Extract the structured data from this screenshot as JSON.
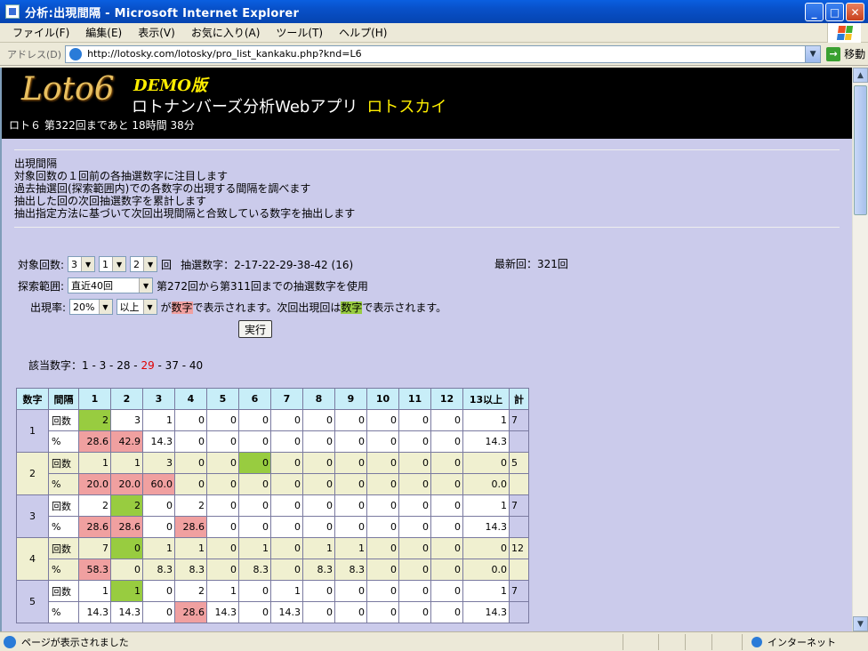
{
  "window": {
    "title": "分析:出現間隔 - Microsoft Internet Explorer"
  },
  "menu": [
    "ファイル(F)",
    "編集(E)",
    "表示(V)",
    "お気に入り(A)",
    "ツール(T)",
    "ヘルプ(H)"
  ],
  "address": {
    "label": "アドレス(D)",
    "url": "http://lotosky.com/lotosky/pro_list_kankaku.php?knd=L6",
    "go_label": "移動"
  },
  "header": {
    "logo": "Loto6",
    "demo": "DEMO版",
    "app_name": "ロトナンバーズ分析Webアプリ",
    "brand": "ロトスカイ",
    "countdown": "ロト６ 第322回まであと 18時間 38分"
  },
  "description": [
    "出現間隔",
    "対象回数の１回前の各抽選数字に注目します",
    "過去抽選回(探索範囲内)での各数字の出現する間隔を調べます",
    "抽出した回の次回抽選数字を累計します",
    "抽出指定方法に基づいて次回出現間隔と合致している数字を抽出します"
  ],
  "form": {
    "target_label": "対象回数:",
    "target_digits": [
      "3",
      "1",
      "2"
    ],
    "target_suffix": "回",
    "drawn_numbers": "抽選数字：2-17-22-29-38-42 (16)",
    "latest": "最新回：321回",
    "range_label": "探索範囲:",
    "range_value": "直近40回",
    "range_note": "第272回から第311回までの抽選数字を使用",
    "rate_label": "出現率:",
    "rate_value": "20%",
    "rate_cmp": "以上",
    "rate_note_1": "が",
    "rate_word_red": "数字",
    "rate_note_2": "で表示されます。次回出現回は",
    "rate_word_green": "数字",
    "rate_note_3": "で表示されます。",
    "submit": "実行"
  },
  "matched": {
    "label": "該当数字：",
    "pre": "1 - 3 - 28 - ",
    "red": "29",
    "post": " - 37 - 40"
  },
  "table": {
    "headers": [
      "数字",
      "間隔",
      "1",
      "2",
      "3",
      "4",
      "5",
      "6",
      "7",
      "8",
      "9",
      "10",
      "11",
      "12",
      "13以上",
      "計"
    ],
    "count_label": "回数",
    "pct_label": "%",
    "rows": [
      {
        "digit": "1",
        "counts": [
          "2",
          "3",
          "1",
          "0",
          "0",
          "0",
          "0",
          "0",
          "0",
          "0",
          "0",
          "0",
          "1"
        ],
        "total": "7",
        "pcts": [
          "28.6",
          "42.9",
          "14.3",
          "0",
          "0",
          "0",
          "0",
          "0",
          "0",
          "0",
          "0",
          "0",
          "14.3"
        ],
        "green": [
          0
        ],
        "red": [
          0,
          1
        ]
      },
      {
        "digit": "2",
        "counts": [
          "1",
          "1",
          "3",
          "0",
          "0",
          "0",
          "0",
          "0",
          "0",
          "0",
          "0",
          "0",
          "0"
        ],
        "total": "5",
        "pcts": [
          "20.0",
          "20.0",
          "60.0",
          "0",
          "0",
          "0",
          "0",
          "0",
          "0",
          "0",
          "0",
          "0",
          "0.0"
        ],
        "green": [
          5
        ],
        "red": [
          0,
          1,
          2
        ]
      },
      {
        "digit": "3",
        "counts": [
          "2",
          "2",
          "0",
          "2",
          "0",
          "0",
          "0",
          "0",
          "0",
          "0",
          "0",
          "0",
          "1"
        ],
        "total": "7",
        "pcts": [
          "28.6",
          "28.6",
          "0",
          "28.6",
          "0",
          "0",
          "0",
          "0",
          "0",
          "0",
          "0",
          "0",
          "14.3"
        ],
        "green": [
          1
        ],
        "red": [
          0,
          1,
          3
        ]
      },
      {
        "digit": "4",
        "counts": [
          "7",
          "0",
          "1",
          "1",
          "0",
          "1",
          "0",
          "1",
          "1",
          "0",
          "0",
          "0",
          "0"
        ],
        "total": "12",
        "pcts": [
          "58.3",
          "0",
          "8.3",
          "8.3",
          "0",
          "8.3",
          "0",
          "8.3",
          "8.3",
          "0",
          "0",
          "0",
          "0.0"
        ],
        "green": [
          1
        ],
        "red": [
          0
        ]
      },
      {
        "digit": "5",
        "counts": [
          "1",
          "1",
          "0",
          "2",
          "1",
          "0",
          "1",
          "0",
          "0",
          "0",
          "0",
          "0",
          "1"
        ],
        "total": "7",
        "pcts": [
          "14.3",
          "14.3",
          "0",
          "28.6",
          "14.3",
          "0",
          "14.3",
          "0",
          "0",
          "0",
          "0",
          "0",
          "14.3"
        ],
        "green": [
          1
        ],
        "red": [
          3
        ]
      }
    ]
  },
  "status": {
    "text": "ページが表示されました",
    "zone": "インターネット"
  }
}
